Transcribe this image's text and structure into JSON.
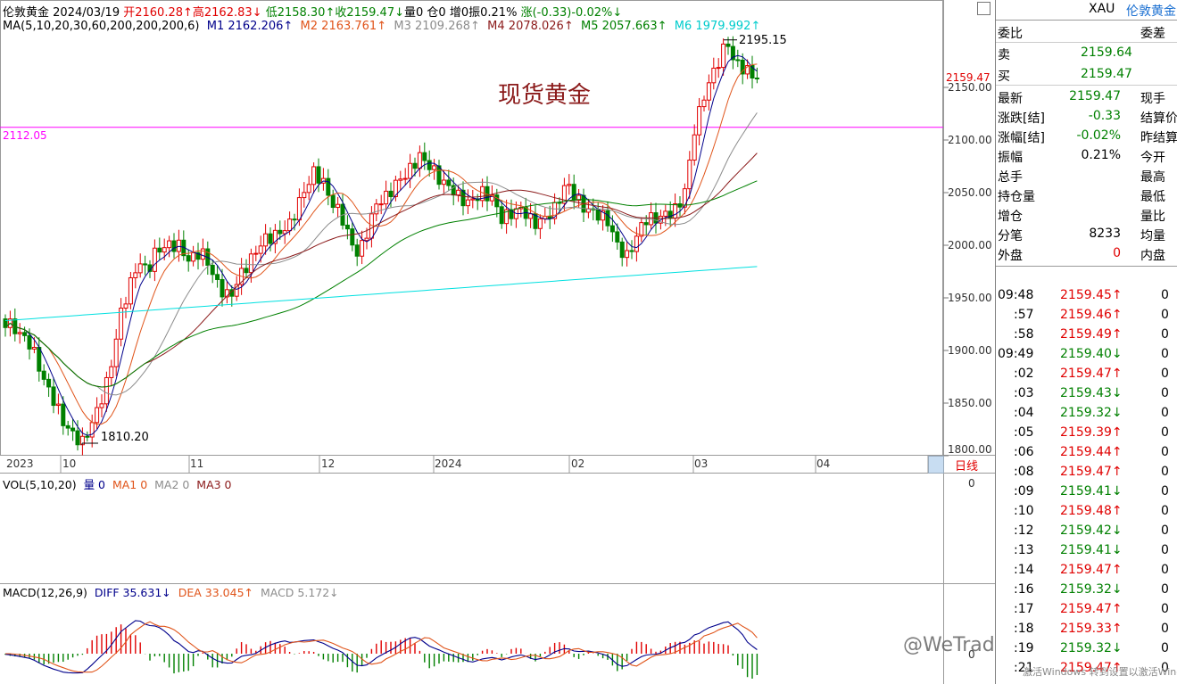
{
  "header": {
    "instrument": "伦敦黄金",
    "date": "2024/03/19",
    "open": "开2160.28↑",
    "high": "高2162.83↓",
    "low": "低2158.30↑",
    "close": "收2159.47↓",
    "volume": "量0",
    "position": "仓0",
    "increase": "增0",
    "amplitude": "振0.21%",
    "change": "涨(-0.33)-0.02%↓"
  },
  "ma_legend": {
    "params": "MA(5,10,20,30,60,200,200,200,6)",
    "m1": "M1 2162.206↑",
    "m2": "M2 2163.761↑",
    "m3": "M3 2109.268↑",
    "m4": "M4 2078.026↑",
    "m5": "M5 2057.663↑",
    "m6": "M6 1979.992↑"
  },
  "chart_title": "现货黄金",
  "annotations": {
    "high_label": "2195.15",
    "low_label": "1810.20",
    "hline_label": "2112.05",
    "last_price": "2159.47"
  },
  "colors": {
    "m1": "#00008b",
    "m2": "#e0541a",
    "m3": "#8c8c8c",
    "m4": "#8b1a1a",
    "m5": "#008000",
    "m6": "#00e0e0",
    "up": "#e00000",
    "down": "#008000",
    "hline": "#ff00ff"
  },
  "price_axis": [
    "2150.00",
    "2100.00",
    "2050.00",
    "2000.00",
    "1950.00",
    "1900.00",
    "1850.00",
    "1800.00"
  ],
  "date_axis": [
    "2023",
    "10",
    "11",
    "12",
    "2024",
    "02",
    "03",
    "04"
  ],
  "period": "日线",
  "vol": {
    "params": "VOL(5,10,20)",
    "v": "量 0",
    "ma1": "MA1 0",
    "ma2": "MA2 0",
    "ma3": "MA3 0",
    "axis": "0"
  },
  "macd": {
    "params": "MACD(12,26,9)",
    "diff": "DIFF 35.631↓",
    "dea": "DEA 33.045↑",
    "macd": "MACD 5.172↓",
    "axis": "0"
  },
  "side": {
    "code": "XAU",
    "name": "伦敦黄金",
    "weibi": "委比",
    "weicha": "委差",
    "sell_label": "卖",
    "sell": "2159.64",
    "buy_label": "买",
    "buy": "2159.47",
    "rows": [
      {
        "l": "最新",
        "v": "2159.47",
        "r": "现手",
        "c": "green"
      },
      {
        "l": "涨跌[结]",
        "v": "-0.33",
        "r": "结算价",
        "c": "green"
      },
      {
        "l": "涨幅[结]",
        "v": "-0.02%",
        "r": "昨结算",
        "c": "green"
      },
      {
        "l": "振幅",
        "v": "0.21%",
        "r": "今开",
        "c": "black"
      },
      {
        "l": "总手",
        "v": "",
        "r": "最高",
        "c": "black"
      },
      {
        "l": "持仓量",
        "v": "",
        "r": "最低",
        "c": "black"
      },
      {
        "l": "增仓",
        "v": "",
        "r": "量比",
        "c": "black"
      },
      {
        "l": "分笔",
        "v": "8233",
        "r": "均量",
        "c": "black"
      },
      {
        "l": "外盘",
        "v": "0",
        "r": "内盘",
        "c": "red"
      }
    ],
    "ticks": [
      {
        "t": "09:48",
        "p": "2159.45↑",
        "v": "0",
        "c": "red"
      },
      {
        "t": ":57",
        "p": "2159.46↑",
        "v": "0",
        "c": "red"
      },
      {
        "t": ":58",
        "p": "2159.49↑",
        "v": "0",
        "c": "red"
      },
      {
        "t": "09:49",
        "p": "2159.40↓",
        "v": "0",
        "c": "green"
      },
      {
        "t": ":02",
        "p": "2159.47↑",
        "v": "0",
        "c": "red"
      },
      {
        "t": ":03",
        "p": "2159.43↓",
        "v": "0",
        "c": "green"
      },
      {
        "t": ":04",
        "p": "2159.32↓",
        "v": "0",
        "c": "green"
      },
      {
        "t": ":05",
        "p": "2159.39↑",
        "v": "0",
        "c": "red"
      },
      {
        "t": ":06",
        "p": "2159.44↑",
        "v": "0",
        "c": "red"
      },
      {
        "t": ":08",
        "p": "2159.47↑",
        "v": "0",
        "c": "red"
      },
      {
        "t": ":09",
        "p": "2159.41↓",
        "v": "0",
        "c": "green"
      },
      {
        "t": ":10",
        "p": "2159.48↑",
        "v": "0",
        "c": "red"
      },
      {
        "t": ":12",
        "p": "2159.42↓",
        "v": "0",
        "c": "green"
      },
      {
        "t": ":13",
        "p": "2159.41↓",
        "v": "0",
        "c": "green"
      },
      {
        "t": ":14",
        "p": "2159.47↑",
        "v": "0",
        "c": "red"
      },
      {
        "t": ":16",
        "p": "2159.32↓",
        "v": "0",
        "c": "green"
      },
      {
        "t": ":17",
        "p": "2159.47↑",
        "v": "0",
        "c": "red"
      },
      {
        "t": ":18",
        "p": "2159.33↑",
        "v": "0",
        "c": "red"
      },
      {
        "t": ":19",
        "p": "2159.32↓",
        "v": "0",
        "c": "green"
      },
      {
        "t": ":21",
        "p": "2159.47↑",
        "v": "0",
        "c": "red"
      }
    ]
  },
  "watermark": "@WeTrade众汇官方",
  "activation_hint": "激活Windows 转到设置以激活Windows"
}
